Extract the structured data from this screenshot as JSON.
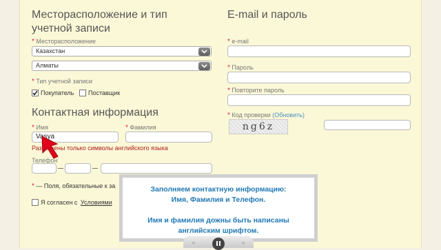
{
  "location_section": {
    "title": "Месторасположение и тип учетной записи",
    "location_label": "Месторасположение",
    "country": "Казахстан",
    "city": "Алматы",
    "account_type_label": "Тип учетной записи",
    "buyer": "Покупатель",
    "supplier": "Поставщик",
    "buyer_checked": true,
    "supplier_checked": false
  },
  "contact_section": {
    "title": "Контактная информация",
    "name_label": "Имя",
    "name_value": "Vasya",
    "surname_label": "Фамилия",
    "error": "Разрешены только символы английского языка",
    "phone_label": "Телефон"
  },
  "required_note": "— Поля, обязательные к за",
  "agree_prefix": "Я согласен с",
  "agree_link": "Условиями",
  "email_section": {
    "title": "E-mail и пароль",
    "email_label": "e-mail",
    "password_label": "Пароль",
    "repeat_label": "Повторите пароль",
    "captcha_label": "Код проверки",
    "refresh": "(Обновить)",
    "captcha_text": "ng6z"
  },
  "tooltip": {
    "line1": "Заполняем контактную информацию:",
    "line2": "Имя, Фамилия и Телефон.",
    "line3": "Имя и фамилия дожны быть написаны",
    "line4": "английским шрифтом."
  },
  "player": {
    "rewind": "«",
    "forward": "»"
  },
  "colors": {
    "accent_blue": "#1f78b4",
    "error_red": "#b02020",
    "required_star": "#dd2244",
    "pointer_red": "#e0001b"
  }
}
